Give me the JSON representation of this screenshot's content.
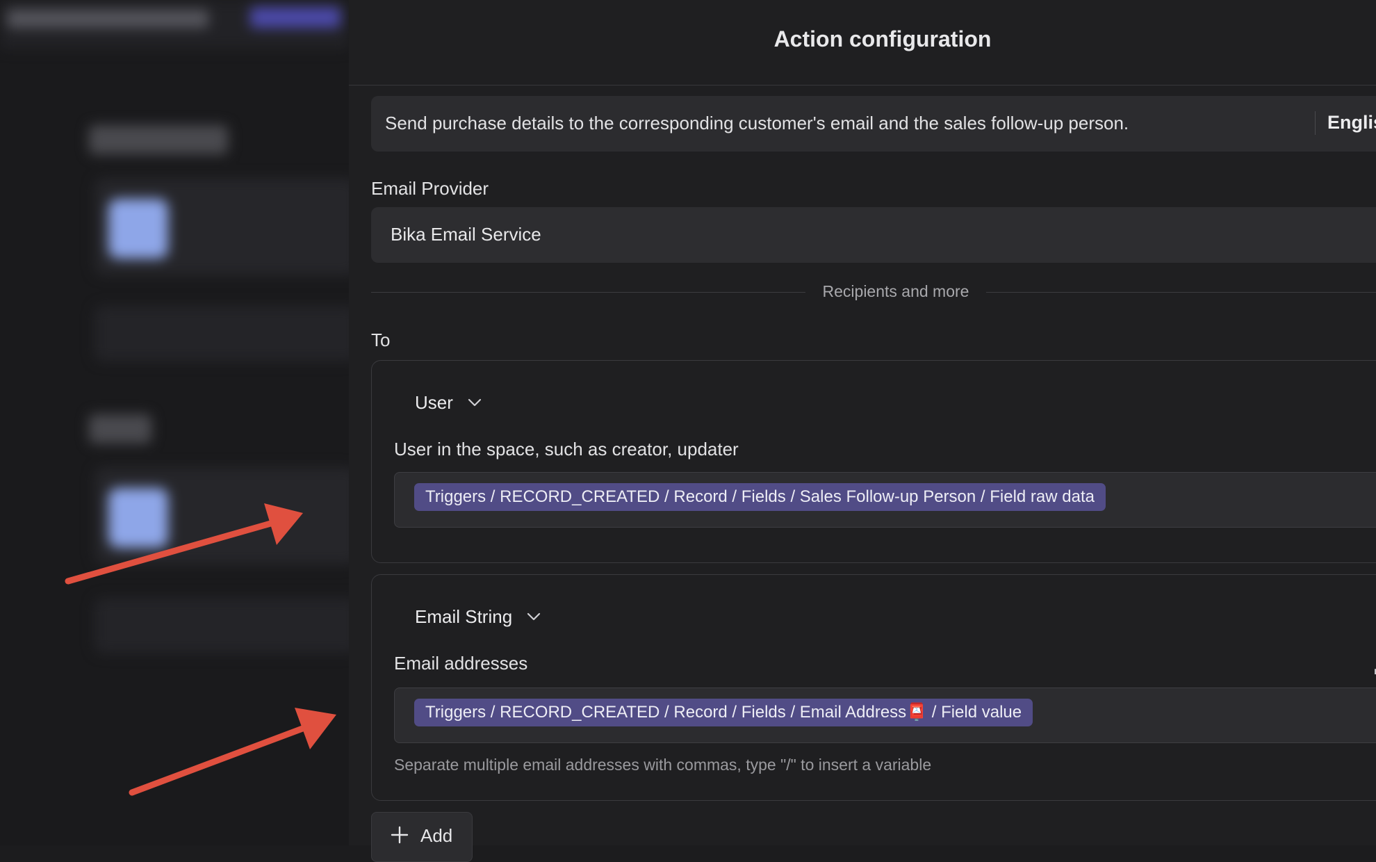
{
  "panel": {
    "title": "Action configuration",
    "description": "Send purchase details to the corresponding customer's email and the sales follow-up person.",
    "language": "English"
  },
  "provider": {
    "label": "Email Provider",
    "value": "Bika Email Service"
  },
  "divider_text": "Recipients and more",
  "to": {
    "label": "To",
    "recipients": [
      {
        "type": "User",
        "field_label": "User in the space, such as creator, updater",
        "variable": "Triggers / RECORD_CREATED / Record / Fields / Sales Follow-up Person / Field raw data"
      },
      {
        "type": "Email String",
        "field_label": "Email addresses",
        "variable": "Triggers / RECORD_CREATED / Record / Fields / Email Address📮 / Field value",
        "hint": "Separate multiple email addresses with commas, type \"/\" to insert a variable"
      }
    ],
    "add_label": "Add"
  },
  "colors": {
    "background": "#1c1c1e",
    "panel": "#1f1f21",
    "chip": "#514c86",
    "annotation_arrow": "#e0503f"
  }
}
